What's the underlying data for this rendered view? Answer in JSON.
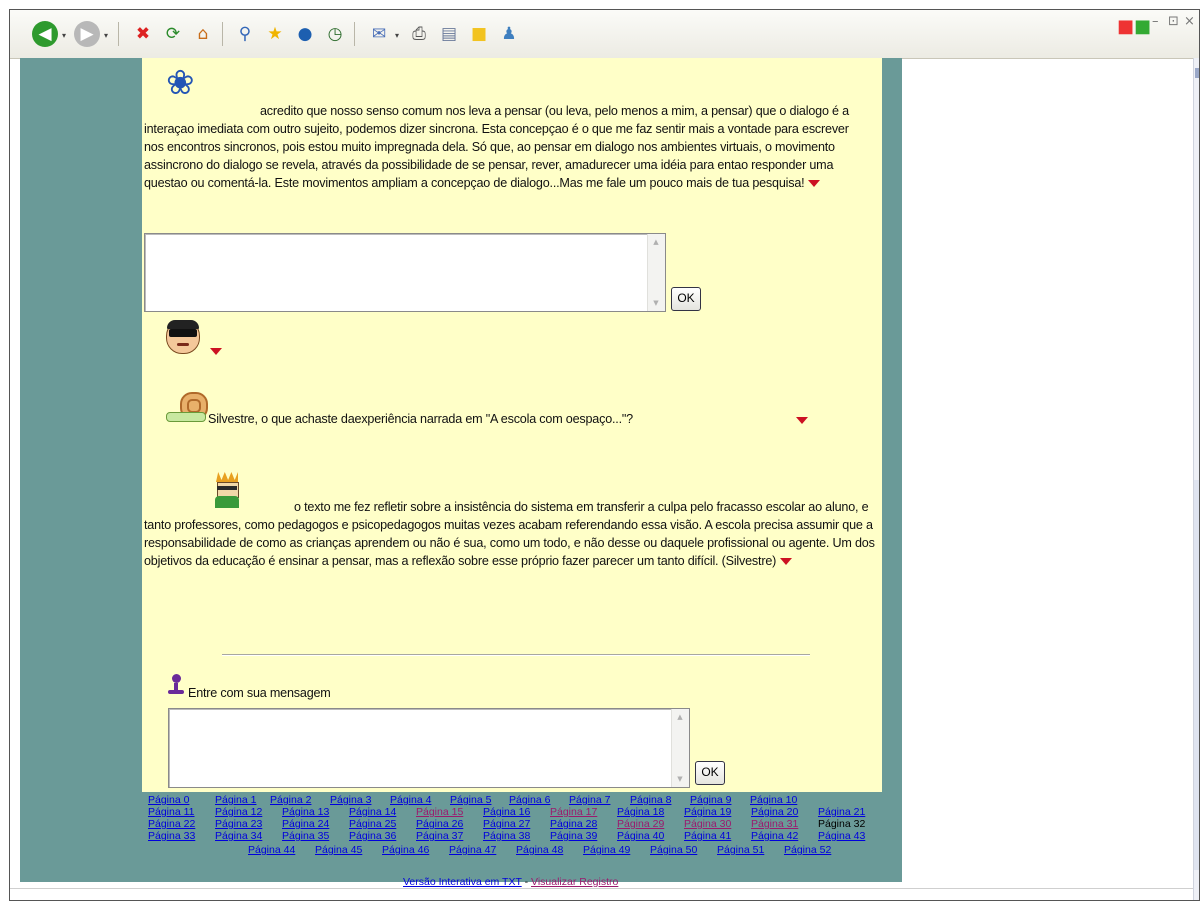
{
  "toolbar": {
    "back_icon": "back-arrow-icon",
    "dropdown_glyph": "▾"
  },
  "messages": [
    {
      "avatar": "butterfly-icon",
      "text": "acredito que nosso senso comum nos leva a pensar (ou leva, pelo menos a mim, a pensar) que o dialogo é a interaçao imediata com outro sujeito, podemos dizer sincrona. Esta concepçao é o que me faz sentir mais a vontade para escrever nos encontros sincronos, pois estou muito impregnada dela. Só que, ao pensar em dialogo nos ambientes virtuais, o movimento assincrono do dialogo se revela, através da possibilidade de se pensar, rever, amadurecer uma idéia para entao responder uma questao ou comentá-la. Este movimentos ampliam a concepçao de dialogo...Mas me fale um pouco mais de tua pesquisa!"
    },
    {
      "avatar": "masked-face-icon",
      "text": ""
    },
    {
      "avatar": "snail-icon",
      "text": "Silvestre, o que achaste daexperiência narrada em \"A escola com oespaço...\"?"
    },
    {
      "avatar": "crazy-hair-face-icon",
      "text": "o texto me fez refletir sobre a insistência do sistema em transferir a culpa pelo fracasso escolar ao aluno, e tanto professores, como pedagogos e psicopedagogos muitas vezes acabam referendando essa visão. A escola precisa assumir que a responsabilidade de como as crianças aprendem ou não é sua, como um todo, e não desse ou daquele profissional ou agente. Um dos objetivos da educação é ensinar a pensar, mas a reflexão sobre esse próprio fazer parecer um tanto difícil. (Silvestre)"
    }
  ],
  "reply_form": {
    "ok_label": "OK",
    "value": ""
  },
  "compose": {
    "icon": "purple-figure-icon",
    "label": "Entre com sua mensagem",
    "ok_label": "OK",
    "value": ""
  },
  "pagination": {
    "rows": [
      [
        {
          "label": "Página 0",
          "state": "link"
        },
        {
          "label": "Página 1",
          "state": "link"
        },
        {
          "label": "Página 2",
          "state": "link"
        },
        {
          "label": "Página 3",
          "state": "link"
        },
        {
          "label": "Página 4",
          "state": "link"
        },
        {
          "label": "Página 5",
          "state": "link"
        },
        {
          "label": "Página 6",
          "state": "link"
        },
        {
          "label": "Página 7",
          "state": "link"
        },
        {
          "label": "Página 8",
          "state": "link"
        },
        {
          "label": "Página 9",
          "state": "link"
        },
        {
          "label": "Página 10",
          "state": "link"
        }
      ],
      [
        {
          "label": "Página 11",
          "state": "link"
        },
        {
          "label": "Página 12",
          "state": "link"
        },
        {
          "label": "Página 13",
          "state": "link"
        },
        {
          "label": "Página 14",
          "state": "link"
        },
        {
          "label": "Página 15",
          "state": "visited"
        },
        {
          "label": "Página 16",
          "state": "link"
        },
        {
          "label": "Página 17",
          "state": "visited"
        },
        {
          "label": "Página 18",
          "state": "link"
        },
        {
          "label": "Página 19",
          "state": "link"
        },
        {
          "label": "Página 20",
          "state": "link"
        },
        {
          "label": "Página 21",
          "state": "link"
        }
      ],
      [
        {
          "label": "Página 22",
          "state": "link"
        },
        {
          "label": "Página 23",
          "state": "link"
        },
        {
          "label": "Página 24",
          "state": "link"
        },
        {
          "label": "Página 25",
          "state": "link"
        },
        {
          "label": "Página 26",
          "state": "link"
        },
        {
          "label": "Página 27",
          "state": "link"
        },
        {
          "label": "Página 28",
          "state": "link"
        },
        {
          "label": "Página 29",
          "state": "visited"
        },
        {
          "label": "Página 30",
          "state": "visited"
        },
        {
          "label": "Página 31",
          "state": "visited"
        },
        {
          "label": "Página 32",
          "state": "current"
        }
      ],
      [
        {
          "label": "Página 33",
          "state": "link"
        },
        {
          "label": "Página 34",
          "state": "link"
        },
        {
          "label": "Página 35",
          "state": "link"
        },
        {
          "label": "Página 36",
          "state": "link"
        },
        {
          "label": "Página 37",
          "state": "link"
        },
        {
          "label": "Página 38",
          "state": "link"
        },
        {
          "label": "Página 39",
          "state": "link"
        },
        {
          "label": "Página 40",
          "state": "link"
        },
        {
          "label": "Página 41",
          "state": "link"
        },
        {
          "label": "Página 42",
          "state": "link"
        },
        {
          "label": "Página 43",
          "state": "link"
        }
      ],
      [
        {
          "label": "Página 44",
          "state": "link"
        },
        {
          "label": "Página 45",
          "state": "link"
        },
        {
          "label": "Página 46",
          "state": "link"
        },
        {
          "label": "Página 47",
          "state": "link"
        },
        {
          "label": "Página 48",
          "state": "link"
        },
        {
          "label": "Página 49",
          "state": "link"
        },
        {
          "label": "Página 50",
          "state": "link"
        },
        {
          "label": "Página 51",
          "state": "link"
        },
        {
          "label": "Página 52",
          "state": "link"
        }
      ]
    ]
  },
  "footer": {
    "text_link": "Versão Interativa em TXT",
    "separator": " - ",
    "registry_link": "Visualizar Registro"
  },
  "colors": {
    "page_bg": "#6a9a98",
    "content_bg": "#ffffc8",
    "link": "#0000dd",
    "visited_link": "#9b1a6e",
    "arrow": "#cc1122"
  }
}
